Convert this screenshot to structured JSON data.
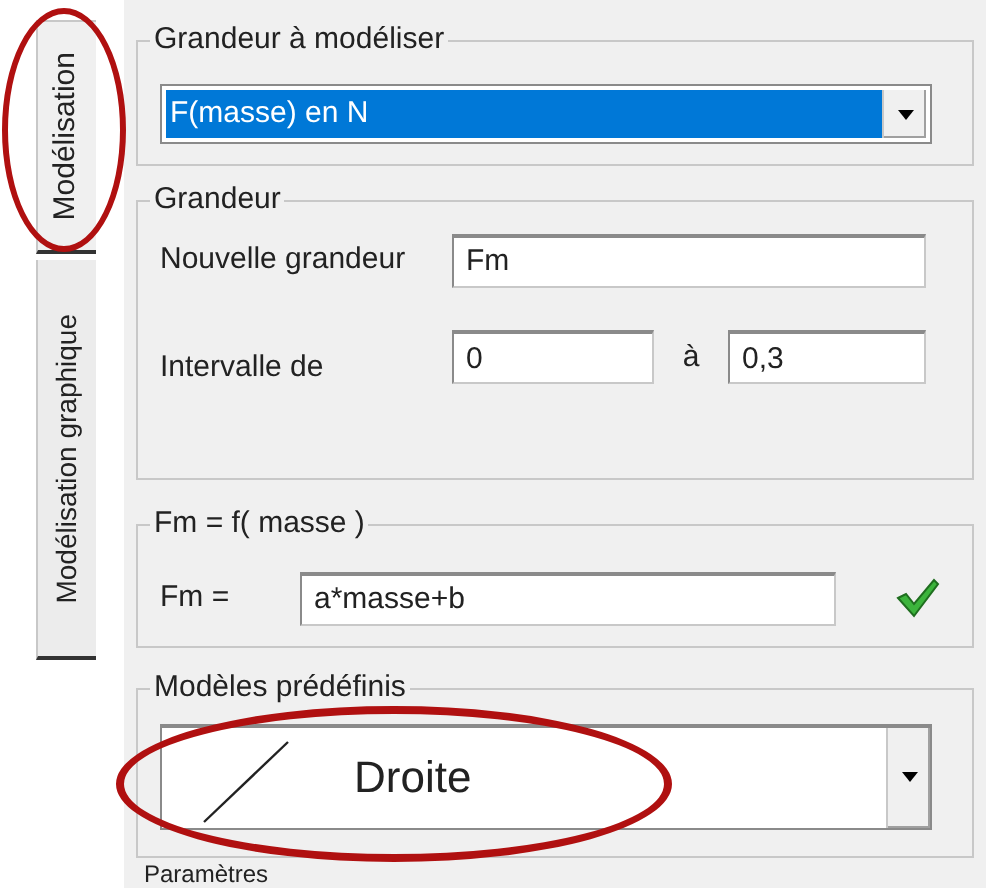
{
  "tabs": [
    {
      "label": "Modélisation",
      "selected": true
    },
    {
      "label": "Modélisation graphique",
      "selected": false
    }
  ],
  "quantity_group": {
    "title": "Grandeur à modéliser",
    "value": "F(masse) en N",
    "highlighted": true
  },
  "grandeur_group": {
    "title": "Grandeur",
    "new_label": "Nouvelle grandeur",
    "new_value": "Fm",
    "interval_label": "Intervalle de",
    "from_value": "0",
    "to_label": "à",
    "to_value": "0,3"
  },
  "formula_group": {
    "title": "Fm = f( masse )",
    "label": "Fm =",
    "value": "a*masse+b",
    "valid": true
  },
  "models_group": {
    "title": "Modèles prédéfinis",
    "value": "Droite"
  },
  "next_group": {
    "title": "Paramètres"
  },
  "annotations": [
    {
      "kind": "ellipse"
    },
    {
      "kind": "ellipse"
    }
  ]
}
